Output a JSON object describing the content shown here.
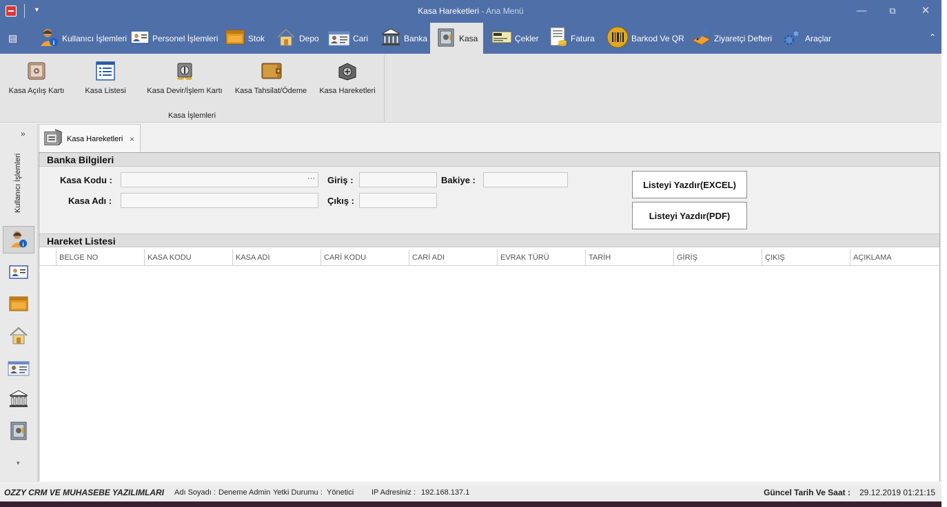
{
  "window": {
    "title": "Kasa Hareketleri",
    "subtitle": " - Ana Menü",
    "minimize": "—",
    "restore": "⧉",
    "close": "✕"
  },
  "ribbon": {
    "menu_icon": "▤",
    "collapse_icon": "⌃",
    "tabs": [
      {
        "label": "Kullanıcı İşlemleri",
        "icon": "user-info-icon"
      },
      {
        "label": "Personel İşlemleri",
        "icon": "id-card-icon"
      },
      {
        "label": "Stok",
        "icon": "box-icon"
      },
      {
        "label": "Depo",
        "icon": "house-icon"
      },
      {
        "label": "Cari",
        "icon": "contact-card-icon"
      },
      {
        "label": "Banka",
        "icon": "bank-icon"
      },
      {
        "label": "Kasa",
        "icon": "safe-icon"
      },
      {
        "label": "Çekler",
        "icon": "check-icon"
      },
      {
        "label": "Fatura",
        "icon": "invoice-icon"
      },
      {
        "label": "Barkod Ve QR",
        "icon": "barcode-icon"
      },
      {
        "label": "Ziyaretçi Defteri",
        "icon": "guestbook-icon"
      },
      {
        "label": "Araçlar",
        "icon": "gears-icon"
      }
    ],
    "active_tab": "Kasa",
    "group_label": "Kasa İşlemleri",
    "buttons": [
      {
        "label": "Kasa Açılış Kartı",
        "icon": "safe-open-icon"
      },
      {
        "label": "Kasa Listesi",
        "icon": "list-icon"
      },
      {
        "label": "Kasa Devir/İşlem Kartı",
        "icon": "vault-transfer-icon"
      },
      {
        "label": "Kasa Tahsilat/Ödeme",
        "icon": "wallet-icon"
      },
      {
        "label": "Kasa Hareketleri",
        "icon": "vault-movements-icon"
      }
    ]
  },
  "sidebar": {
    "expand": "»",
    "title": "Kullanıcı İşlemleri",
    "more": "▾"
  },
  "doc_tab": {
    "label": "Kasa Hareketleri",
    "close": "×"
  },
  "form": {
    "section_title": "Banka Bilgileri",
    "kasa_kodu_label": "Kasa Kodu :",
    "kasa_kodu_value": "",
    "ellipsis": "···",
    "kasa_adi_label": "Kasa Adı :",
    "kasa_adi_value": "",
    "giris_label": "Giriş :",
    "giris_value": "",
    "cikis_label": "Çıkış :",
    "cikis_value": "",
    "bakiye_label": "Bakiye :",
    "bakiye_value": "",
    "excel_button": "Listeyi Yazdır(EXCEL)",
    "pdf_button": "Listeyi Yazdır(PDF)"
  },
  "grid": {
    "section_title": "Hareket Listesi",
    "columns": [
      "BELGE NO",
      "KASA KODU",
      "KASA ADI",
      "CARİ KODU",
      "CARİ ADI",
      "EVRAK TÜRÜ",
      "TARİH",
      "GİRİŞ",
      "ÇIKIŞ",
      "AÇIKLAMA"
    ],
    "rows": []
  },
  "status": {
    "company": "OZZY CRM VE MUHASEBE YAZILIMLARI",
    "user_label": "Adı Soyadı :",
    "user_value": "Deneme Admin",
    "role_label": "Yetki Durumu :",
    "role_value": "Yönetici",
    "ip_label": "IP Adresiniz :",
    "ip_value": "192.168.137.1",
    "datetime_label": "Güncel Tarih Ve Saat :",
    "datetime_value": "29.12.2019 01:21:15"
  }
}
